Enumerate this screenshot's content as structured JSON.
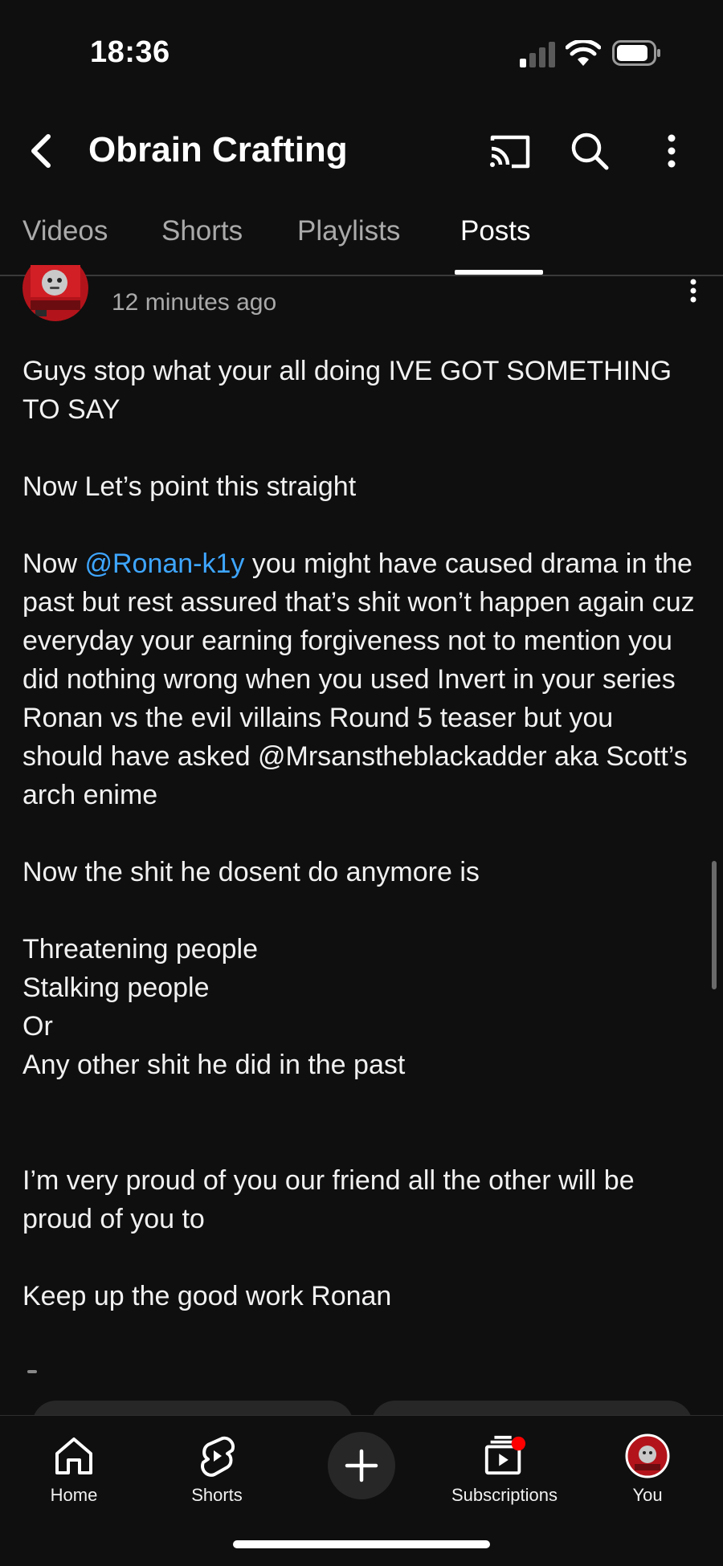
{
  "status_bar": {
    "time": "18:36",
    "icons": [
      "cellular-signal-icon",
      "wifi-icon",
      "battery-icon"
    ]
  },
  "header": {
    "channel_title": "Obrain Crafting",
    "icons": [
      "back-arrow-icon",
      "cast-icon",
      "search-icon",
      "more-vertical-icon"
    ]
  },
  "tabs": [
    {
      "label": "Videos",
      "active": false
    },
    {
      "label": "Shorts",
      "active": false
    },
    {
      "label": "Playlists",
      "active": false
    },
    {
      "label": "Posts",
      "active": true
    }
  ],
  "post": {
    "time_ago": "12 minutes ago",
    "paragraph_1": "Guys stop what your all doing IVE GOT SOMETHING TO SAY",
    "paragraph_2": "Now Let’s point this straight",
    "paragraph_3_prefix": "Now ",
    "paragraph_3_mention": "@Ronan-k1y",
    "paragraph_3_rest": " you might have caused drama in the past but rest assured that’s shit won’t happen again cuz everyday your earning forgiveness not to mention you did nothing wrong when you used Invert in your series Ronan vs the evil villains Round 5 teaser but you should have asked @Mrsanstheblackadder aka Scott’s arch enime",
    "paragraph_4": "Now the shit he dosent do anymore is",
    "list_items": [
      "Threatening people",
      "Stalking people",
      "Or",
      "Any other shit he did in the past"
    ],
    "paragraph_5": "I’m very proud of you our friend all the other will be proud of you to",
    "paragraph_6": "Keep up the good work Ronan"
  },
  "bottom_nav": [
    {
      "label": "Home",
      "icon": "home-icon"
    },
    {
      "label": "Shorts",
      "icon": "shorts-icon"
    },
    {
      "label": "",
      "icon": "create-plus-icon"
    },
    {
      "label": "Subscriptions",
      "icon": "subscriptions-icon"
    },
    {
      "label": "You",
      "icon": "profile-avatar-icon"
    }
  ],
  "colors": {
    "background": "#0f0f0f",
    "text": "#f1f1f1",
    "secondary_text": "#aaaaaa",
    "mention": "#3ea6ff",
    "notification_dot": "#ff0000"
  }
}
